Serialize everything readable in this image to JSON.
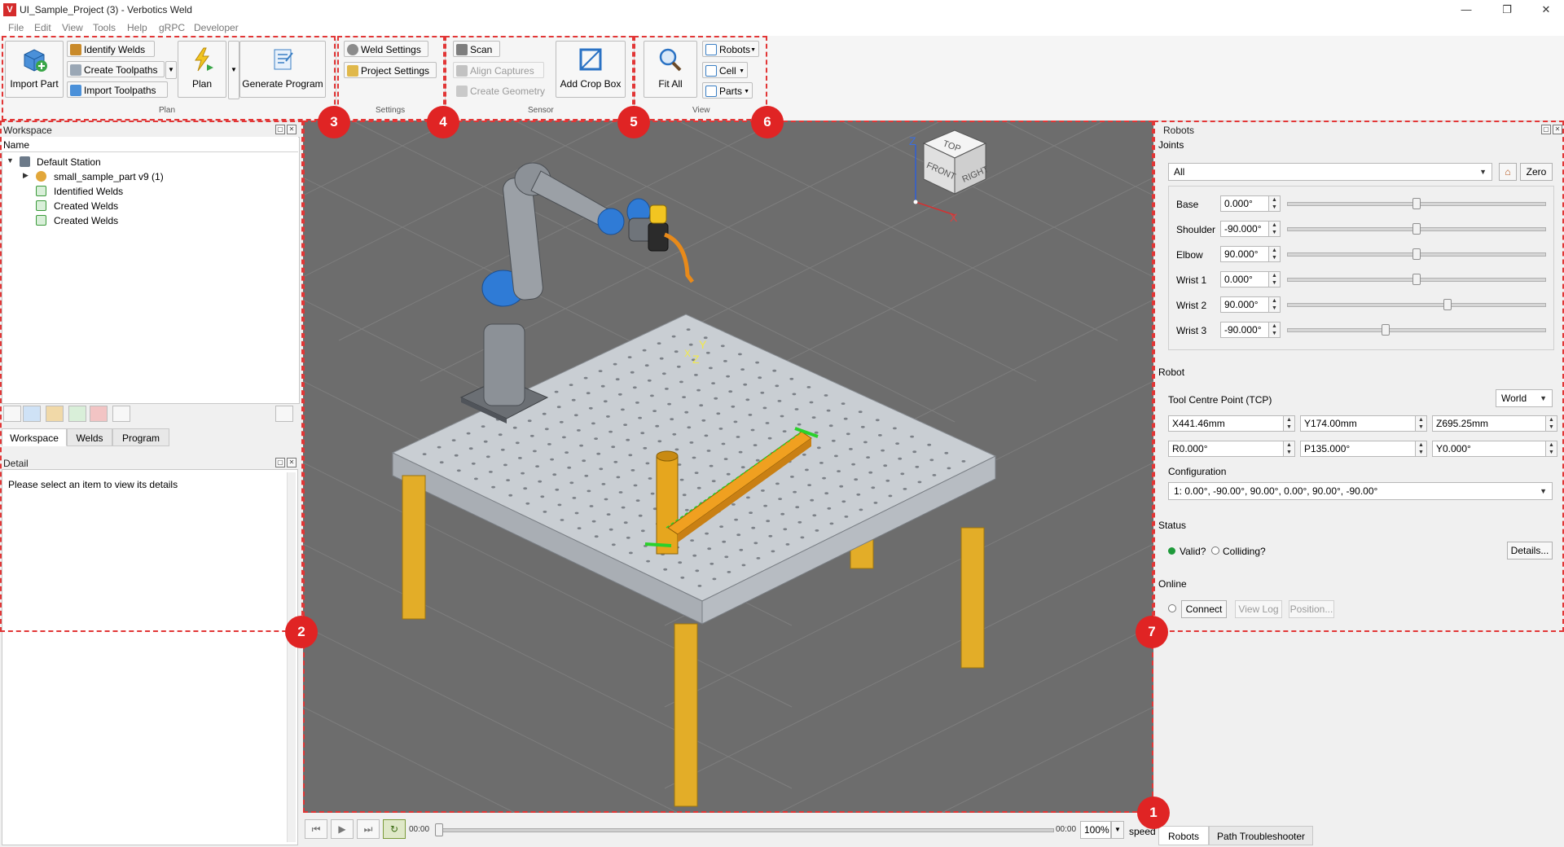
{
  "window": {
    "title": "UI_Sample_Project (3) - Verbotics Weld",
    "minimize": "—",
    "maximize": "❐",
    "close": "✕"
  },
  "menu": [
    "File",
    "Edit",
    "View",
    "Tools",
    "Help",
    "gRPC",
    "Developer"
  ],
  "ribbon": {
    "plan": {
      "label": "Plan",
      "import_part": "Import Part",
      "identify_welds": "Identify Welds",
      "create_toolpaths": "Create Toolpaths",
      "import_toolpaths": "Import Toolpaths",
      "plan": "Plan",
      "generate_program": "Generate Program"
    },
    "settings": {
      "label": "Settings",
      "weld_settings": "Weld Settings",
      "project_settings": "Project Settings"
    },
    "sensor": {
      "label": "Sensor",
      "scan": "Scan",
      "align_captures": "Align Captures",
      "create_geometry": "Create Geometry",
      "add_crop_box": "Add Crop Box"
    },
    "view": {
      "label": "View",
      "fit_all": "Fit All",
      "robots": "Robots",
      "cell": "Cell",
      "parts": "Parts"
    }
  },
  "badges": [
    "1",
    "2",
    "3",
    "4",
    "5",
    "6",
    "7"
  ],
  "workspace": {
    "title": "Workspace",
    "column": "Name",
    "tree": [
      "Default Station",
      "small_sample_part v9 (1)",
      "Identified Welds",
      "Created Welds",
      "Created Welds"
    ],
    "tabs": [
      "Workspace",
      "Welds",
      "Program"
    ]
  },
  "detail": {
    "title": "Detail",
    "message": "Please select an item to view its details"
  },
  "viewcube": {
    "top": "TOP",
    "front": "FRONT",
    "right": "RIGHT",
    "x": "X",
    "z": "Z"
  },
  "axis_labels": {
    "y": "Y",
    "z": "Z",
    "x": "X"
  },
  "playback": {
    "time_start": "00:00",
    "time_end": "00:00",
    "zoom": "100%",
    "speed": "speed"
  },
  "robots_panel": {
    "title": "Robots",
    "joints_label": "Joints",
    "joints_select": "All",
    "zero": "Zero",
    "joints": [
      {
        "name": "Base",
        "value": "0.000°",
        "pos": 0.5
      },
      {
        "name": "Shoulder",
        "value": "-90.000°",
        "pos": 0.5
      },
      {
        "name": "Elbow",
        "value": "90.000°",
        "pos": 0.5
      },
      {
        "name": "Wrist 1",
        "value": "0.000°",
        "pos": 0.5
      },
      {
        "name": "Wrist 2",
        "value": "90.000°",
        "pos": 0.62
      },
      {
        "name": "Wrist 3",
        "value": "-90.000°",
        "pos": 0.38
      }
    ],
    "robot_label": "Robot",
    "tcp_label": "Tool Centre Point (TCP)",
    "tcp_frame": "World",
    "tcp": [
      "X441.46mm",
      "Y174.00mm",
      "Z695.25mm",
      "R0.000°",
      "P135.000°",
      "Y0.000°"
    ],
    "configuration_label": "Configuration",
    "configuration": "1: 0.00°, -90.00°, 90.00°, 0.00°, 90.00°, -90.00°",
    "status_label": "Status",
    "valid": "Valid?",
    "colliding": "Colliding?",
    "details": "Details...",
    "online_label": "Online",
    "connect": "Connect",
    "view_log": "View Log",
    "position": "Position..."
  },
  "bottom_tabs": [
    "Robots",
    "Path Troubleshooter"
  ],
  "colors": {
    "accent_red": "#e02424",
    "table_leg": "#e8b32a",
    "weld_orange": "#f0a020",
    "valid_green": "#1e9a3a"
  }
}
